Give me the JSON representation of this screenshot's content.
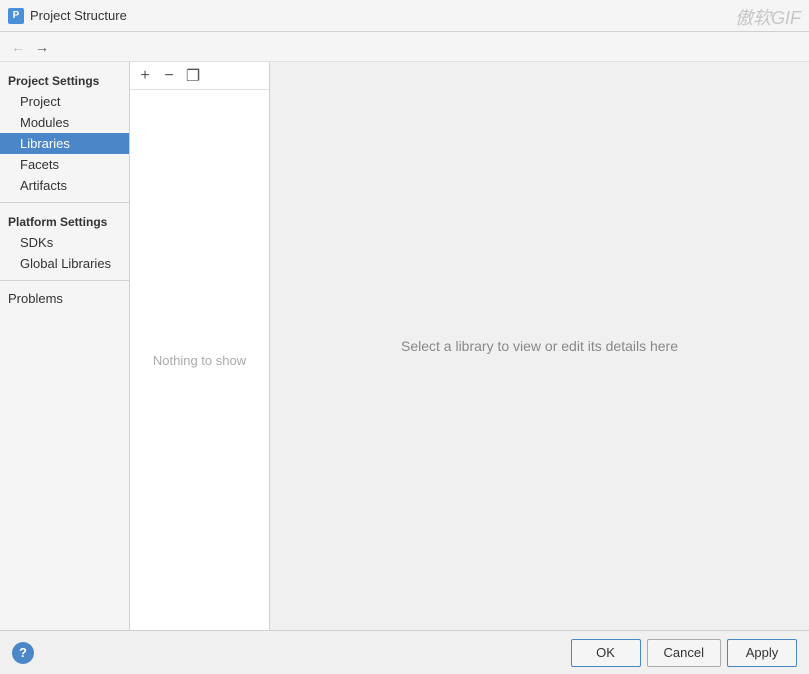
{
  "titleBar": {
    "icon": "P",
    "title": "Project Structure",
    "watermark": "傲软GIF"
  },
  "navBar": {
    "backLabel": "←",
    "forwardLabel": "→"
  },
  "sidebar": {
    "projectSettingsHeader": "Project Settings",
    "items": [
      {
        "id": "project",
        "label": "Project",
        "active": false
      },
      {
        "id": "modules",
        "label": "Modules",
        "active": false
      },
      {
        "id": "libraries",
        "label": "Libraries",
        "active": true
      },
      {
        "id": "facets",
        "label": "Facets",
        "active": false
      },
      {
        "id": "artifacts",
        "label": "Artifacts",
        "active": false
      }
    ],
    "platformSettingsHeader": "Platform Settings",
    "platformItems": [
      {
        "id": "sdks",
        "label": "SDKs",
        "active": false
      },
      {
        "id": "global-libraries",
        "label": "Global Libraries",
        "active": false
      }
    ],
    "problems": "Problems"
  },
  "libraryToolbar": {
    "addLabel": "+",
    "removeLabel": "−",
    "copyLabel": "❐"
  },
  "libraryList": {
    "emptyText": "Nothing to show"
  },
  "rightPanel": {
    "hint": "Select a library to view or edit its details here"
  },
  "bottomBar": {
    "helpLabel": "?",
    "okLabel": "OK",
    "cancelLabel": "Cancel",
    "applyLabel": "Apply"
  }
}
